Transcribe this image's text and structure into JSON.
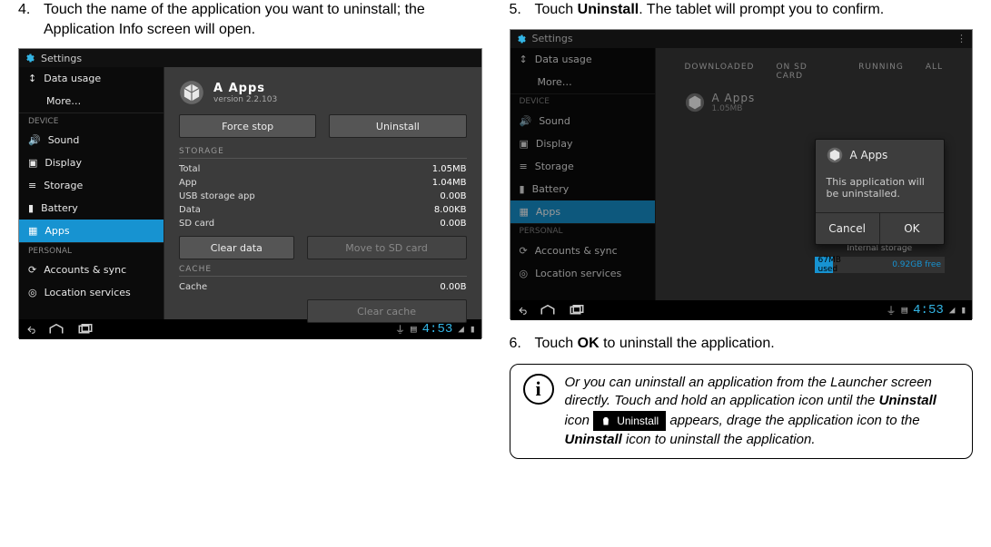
{
  "col1": {
    "step4_num": "4.",
    "step4_text": "Touch the name of the application you want to uninstall; the Application Info screen will open.",
    "shot": {
      "topbar_title": "Settings",
      "side": {
        "items_top": [
          "Data usage",
          "More…"
        ],
        "hdr1": "DEVICE",
        "items_device": [
          "Sound",
          "Display",
          "Storage",
          "Battery",
          "Apps"
        ],
        "selected": "Apps",
        "hdr2": "PERSONAL",
        "items_personal": [
          "Accounts & sync",
          "Location services"
        ]
      },
      "app_name": "A Apps",
      "app_ver": "version 2.2.103",
      "btn_force": "Force stop",
      "btn_uninstall": "Uninstall",
      "sect_storage": "STORAGE",
      "st_rows": [
        [
          "Total",
          "1.05MB"
        ],
        [
          "App",
          "1.04MB"
        ],
        [
          "USB storage app",
          "0.00B"
        ],
        [
          "Data",
          "8.00KB"
        ],
        [
          "SD card",
          "0.00B"
        ]
      ],
      "btn_cleardata": "Clear data",
      "btn_move": "Move to SD card",
      "sect_cache": "CACHE",
      "cache_row": [
        "Cache",
        "0.00B"
      ],
      "btn_clearcache": "Clear cache",
      "clock": "4:53"
    }
  },
  "col2": {
    "step5_num": "5.",
    "step5_text_a": "Touch ",
    "step5_text_b": "Uninstall",
    "step5_text_c": ". The tablet will prompt you to confirm.",
    "shot": {
      "topbar_title": "Settings",
      "side": {
        "items_top": [
          "Data usage",
          "More…"
        ],
        "hdr1": "DEVICE",
        "items_device": [
          "Sound",
          "Display",
          "Storage",
          "Battery",
          "Apps"
        ],
        "selected": "Apps",
        "hdr2": "PERSONAL",
        "items_personal": [
          "Accounts & sync",
          "Location services"
        ]
      },
      "tabs": [
        "DOWNLOADED",
        "ON SD CARD",
        "RUNNING",
        "ALL"
      ],
      "app_row_name": "A Apps",
      "app_row_size": "1.05MB",
      "dialog_title": "A Apps",
      "dialog_msg": "This application will be uninstalled.",
      "dialog_cancel": "Cancel",
      "dialog_ok": "OK",
      "storage_label": "Internal storage",
      "storage_used": "67MB used",
      "storage_free": "0.92GB free",
      "clock": "4:53"
    },
    "step6_num": "6.",
    "step6_text_a": "Touch ",
    "step6_text_b": "OK",
    "step6_text_c": " to uninstall the application.",
    "info": {
      "pre": "Or you can uninstall an application from the Launcher screen directly. Touch and hold an application icon until the ",
      "kw1": "Uninstall",
      "mid": " icon ",
      "chip": "Uninstall",
      "post1": " appears, drage the application icon to the ",
      "kw2": "Uninstall",
      "post2": " icon to uninstall the application."
    }
  }
}
